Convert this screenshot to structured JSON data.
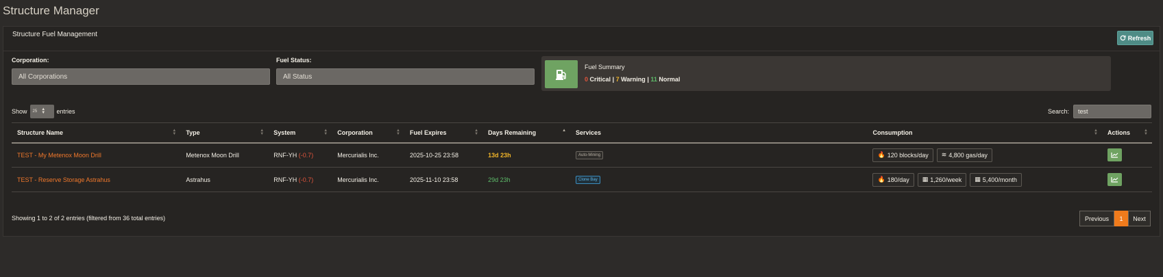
{
  "page": {
    "title": "Structure Manager"
  },
  "card": {
    "title": "Structure Fuel Management",
    "refresh_label": "Refresh"
  },
  "filters": {
    "corporation_label": "Corporation:",
    "corporation_value": "All Corporations",
    "status_label": "Fuel Status:",
    "status_value": "All Status"
  },
  "summary": {
    "title": "Fuel Summary",
    "critical_count": "0",
    "critical_label": "Critical",
    "warning_count": "7",
    "warning_label": "Warning",
    "normal_count": "11",
    "normal_label": "Normal",
    "separator": "|"
  },
  "table_controls": {
    "show_label": "Show",
    "page_size": "25",
    "entries_label": "entries",
    "search_label": "Search:",
    "search_value": "test"
  },
  "columns": [
    "Structure Name",
    "Type",
    "System",
    "Corporation",
    "Fuel Expires",
    "Days Remaining",
    "Services",
    "Consumption",
    "Actions"
  ],
  "rows": [
    {
      "name": "TEST - My Metenox Moon Drill",
      "type": "Metenox Moon Drill",
      "system": "RNF-YH",
      "security": "(-0.7)",
      "corporation": "Mercurialis Inc.",
      "expires": "2025-10-25 23:58",
      "days": "13d 23h",
      "service": "Auto-Mining",
      "consumption": [
        "120 blocks/day",
        "4,800 gas/day"
      ]
    },
    {
      "name": "TEST - Reserve Storage Astrahus",
      "type": "Astrahus",
      "system": "RNF-YH",
      "security": "(-0.7)",
      "corporation": "Mercurialis Inc.",
      "expires": "2025-11-10 23:58",
      "days": "29d 23h",
      "service": "Clone Bay",
      "consumption": [
        "180/day",
        "1,260/week",
        "5,400/month"
      ]
    }
  ],
  "footer": {
    "info": "Showing 1 to 2 of 2 entries (filtered from 36 total entries)",
    "prev_label": "Previous",
    "current_page": "1",
    "next_label": "Next"
  },
  "colors": {
    "accent_orange": "#f07b1c",
    "critical": "#e0543c",
    "warning": "#f0b429",
    "normal": "#5ebb6a",
    "refresh_btn": "#4f8c86"
  }
}
